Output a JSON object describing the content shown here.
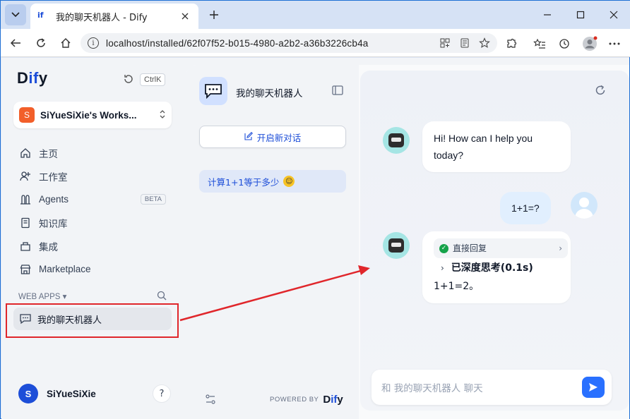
{
  "browser": {
    "tab_title": "我的聊天机器人 - Dify",
    "tab_favicon": "if",
    "url": "localhost/installed/62f07f52-b015-4980-a2b2-a36b3226cb4a"
  },
  "sidebar": {
    "logo_prefix": "D",
    "logo_mid": "if",
    "logo_suffix": "y",
    "shortcut": "CtrlK",
    "workspace": {
      "initial": "S",
      "name": "SiYueSiXie's Works..."
    },
    "nav": [
      {
        "label": "主页",
        "icon": "home-icon"
      },
      {
        "label": "工作室",
        "icon": "studio-icon"
      },
      {
        "label": "Agents",
        "icon": "agents-icon",
        "badge": "BETA"
      },
      {
        "label": "知识库",
        "icon": "knowledge-icon"
      },
      {
        "label": "集成",
        "icon": "integration-icon"
      },
      {
        "label": "Marketplace",
        "icon": "marketplace-icon"
      }
    ],
    "web_apps_title": "WEB APPS ▾",
    "web_app_item": "我的聊天机器人",
    "user": {
      "initial": "S",
      "name": "SiYueSiXie"
    },
    "help": "?"
  },
  "chat_panel": {
    "app_name": "我的聊天机器人",
    "new_chat": "开启新对话",
    "conversation": "计算1+1等于多少",
    "powered_by": "POWERED BY",
    "powered_logo_prefix": "D",
    "powered_logo_mid": "if",
    "powered_logo_suffix": "y"
  },
  "chat": {
    "greeting": "Hi! How can I help you today?",
    "user_message": "1+1=?",
    "workflow_label": "直接回复",
    "thinking_label": "已深度思考(0.1s)",
    "answer": "1+1=2。",
    "input_placeholder": "和 我的聊天机器人 聊天"
  },
  "colors": {
    "accent": "#1d4ed8",
    "annotation_red": "#e0262b",
    "send_button": "#2970ff"
  }
}
